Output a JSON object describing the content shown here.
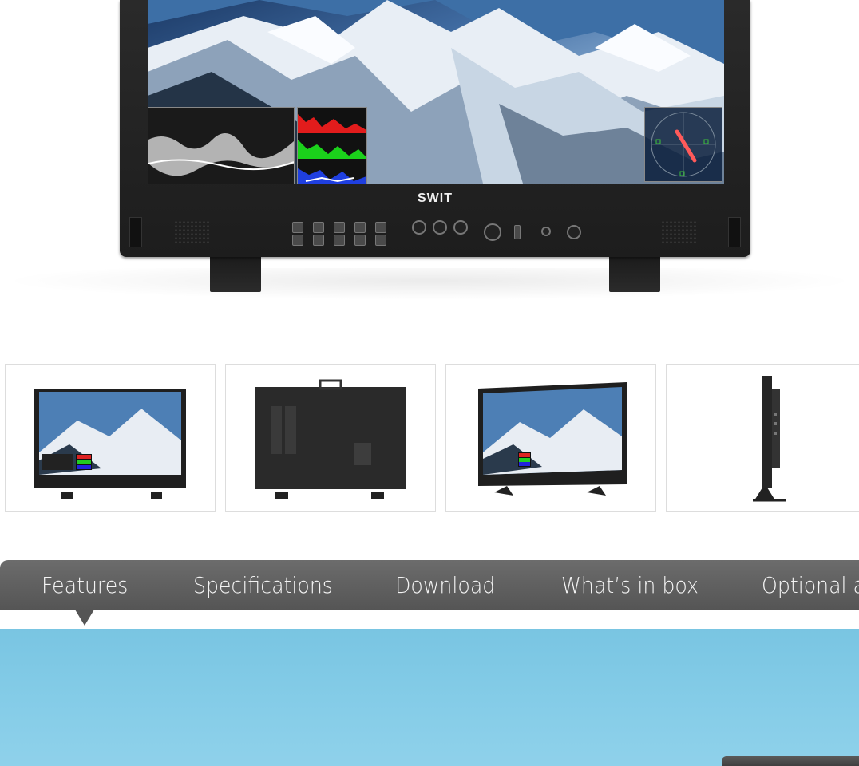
{
  "product": {
    "brand": "SWIT"
  },
  "thumbnails": [
    {
      "view": "front"
    },
    {
      "view": "back"
    },
    {
      "view": "angled-front"
    },
    {
      "view": "side"
    }
  ],
  "tabs": [
    {
      "label": "Features",
      "active": true
    },
    {
      "label": "Specifications",
      "active": false
    },
    {
      "label": "Download",
      "active": false
    },
    {
      "label": "What’s in box",
      "active": false
    },
    {
      "label": "Optional a",
      "active": false
    }
  ],
  "colors": {
    "tab_bar": "#5f5f5f",
    "tab_text": "#f4f4f4",
    "banner_sky": "#86cde8",
    "thumb_border": "#dddddd"
  }
}
